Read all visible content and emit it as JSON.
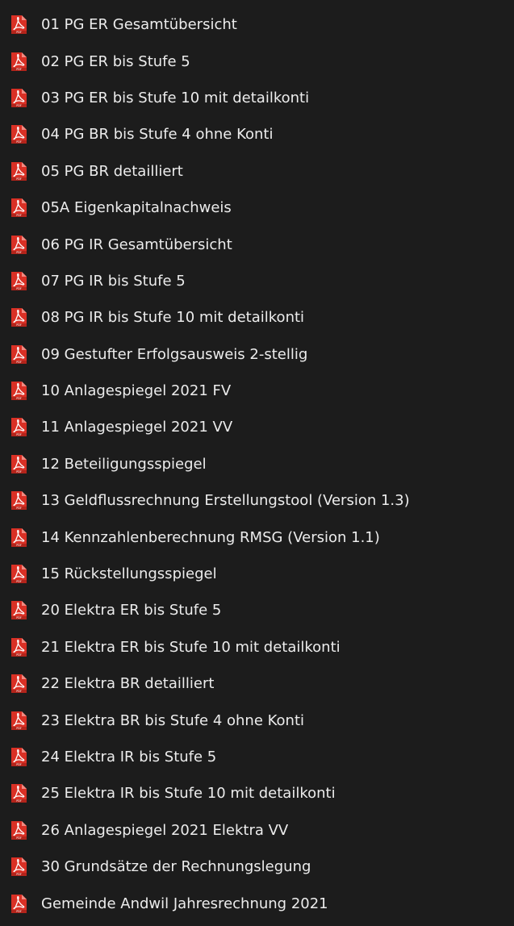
{
  "file_list": {
    "icon": "pdf-file-icon",
    "icon_color": "#d93025",
    "items": [
      {
        "label": "01 PG ER Gesamtübersicht"
      },
      {
        "label": "02 PG ER bis Stufe 5"
      },
      {
        "label": "03 PG ER bis Stufe 10 mit detailkonti"
      },
      {
        "label": "04 PG BR bis Stufe 4 ohne Konti"
      },
      {
        "label": "05 PG BR detailliert"
      },
      {
        "label": "05A Eigenkapitalnachweis"
      },
      {
        "label": "06 PG IR Gesamtübersicht"
      },
      {
        "label": "07 PG IR bis Stufe 5"
      },
      {
        "label": "08 PG IR bis Stufe 10 mit detailkonti"
      },
      {
        "label": "09 Gestufter Erfolgsausweis 2-stellig"
      },
      {
        "label": "10 Anlagespiegel 2021 FV"
      },
      {
        "label": "11 Anlagespiegel 2021 VV"
      },
      {
        "label": "12 Beteiligungsspiegel"
      },
      {
        "label": "13 Geldflussrechnung Erstellungstool (Version 1.3)"
      },
      {
        "label": "14 Kennzahlenberechnung RMSG (Version 1.1)"
      },
      {
        "label": "15 Rückstellungsspiegel"
      },
      {
        "label": "20 Elektra ER bis Stufe 5"
      },
      {
        "label": "21 Elektra ER bis Stufe 10 mit detailkonti"
      },
      {
        "label": "22 Elektra BR detailliert"
      },
      {
        "label": "23 Elektra BR bis Stufe 4 ohne Konti"
      },
      {
        "label": "24 Elektra IR bis Stufe 5"
      },
      {
        "label": "25 Elektra IR bis Stufe 10 mit detailkonti"
      },
      {
        "label": "26 Anlagespiegel 2021 Elektra VV"
      },
      {
        "label": "30 Grundsätze der Rechnungslegung"
      },
      {
        "label": "Gemeinde Andwil Jahresrechnung 2021"
      }
    ]
  }
}
